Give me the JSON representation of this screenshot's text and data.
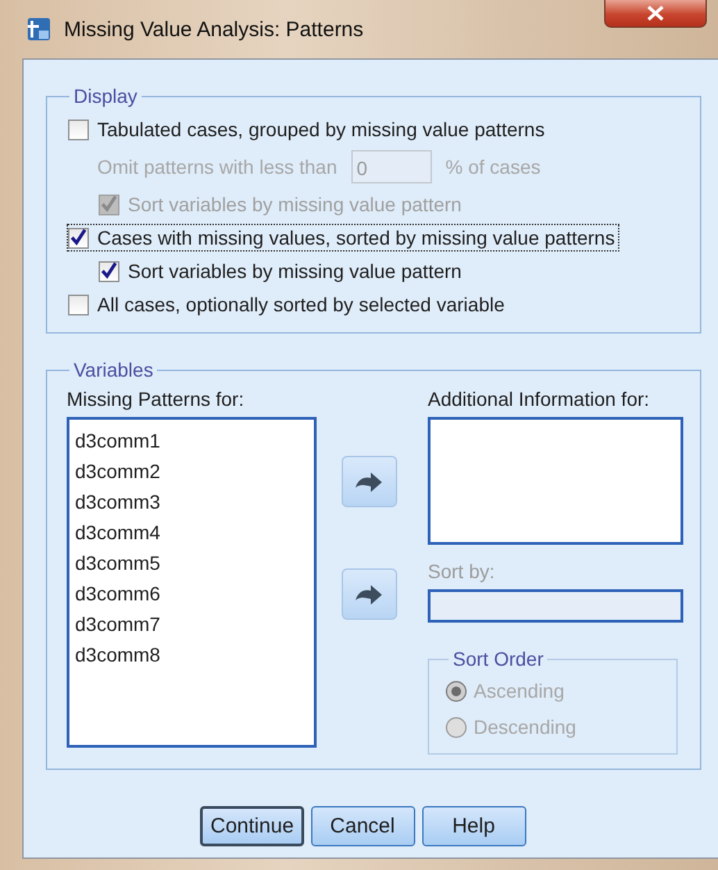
{
  "window": {
    "title": "Missing Value Analysis: Patterns"
  },
  "display": {
    "title": "Display",
    "options": [
      {
        "kind": "checkbox",
        "label": "Tabulated cases, grouped by missing value patterns",
        "checked": false,
        "disabled": false,
        "focused": false,
        "children": [
          {
            "kind": "threshold",
            "label": "Omit patterns with less than",
            "value": "0",
            "suffix": "% of cases",
            "disabled": true
          },
          {
            "kind": "checkbox",
            "label": "Sort variables by missing value pattern",
            "checked": true,
            "disabled": true,
            "focused": false
          }
        ]
      },
      {
        "kind": "checkbox",
        "label": "Cases with missing values, sorted by missing value patterns",
        "checked": true,
        "disabled": false,
        "focused": true,
        "children": [
          {
            "kind": "checkbox",
            "label": "Sort variables by missing value pattern",
            "checked": true,
            "disabled": false,
            "focused": false
          }
        ]
      },
      {
        "kind": "checkbox",
        "label": "All cases, optionally sorted by selected variable",
        "checked": false,
        "disabled": false,
        "focused": false
      }
    ]
  },
  "variables": {
    "title": "Variables",
    "missing_patterns_label": "Missing Patterns for:",
    "missing_patterns": [
      "d3comm1",
      "d3comm2",
      "d3comm3",
      "d3comm4",
      "d3comm5",
      "d3comm6",
      "d3comm7",
      "d3comm8"
    ],
    "additional_label": "Additional Information for:",
    "sort_by_label": "Sort by:",
    "sort_order": {
      "title": "Sort Order",
      "disabled": true,
      "options": [
        {
          "label": "Ascending",
          "selected": true
        },
        {
          "label": "Descending",
          "selected": false
        }
      ]
    }
  },
  "buttons": [
    {
      "label": "Continue",
      "default": true
    },
    {
      "label": "Cancel",
      "default": false
    },
    {
      "label": "Help",
      "default": false
    }
  ]
}
